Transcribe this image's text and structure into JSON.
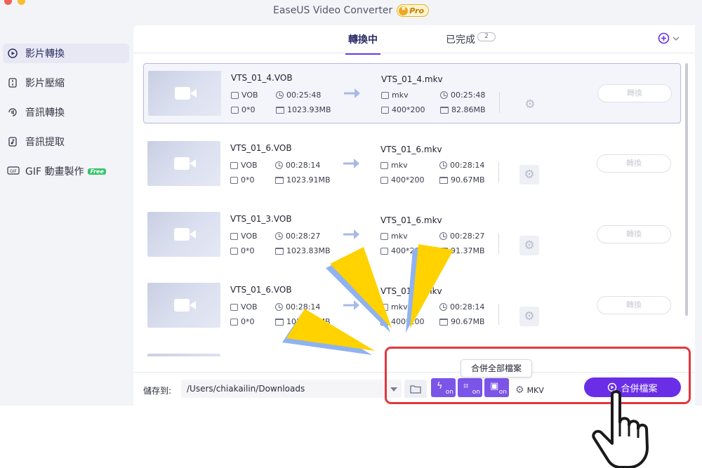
{
  "app": {
    "title": "EaseUS Video Converter",
    "pro_badge": "Pro"
  },
  "colors": {
    "accent": "#6a2ee6",
    "selected_row_border": "#b9b6e9",
    "highlight_box": "#e3373c",
    "burst_yellow": "#ffd200",
    "burst_blue": "#8fb2f0"
  },
  "sidebar": {
    "items": [
      {
        "label": "影片轉換",
        "icon": "video-convert-icon",
        "active": true
      },
      {
        "label": "影片壓縮",
        "icon": "compress-icon",
        "active": false
      },
      {
        "label": "音訊轉換",
        "icon": "audio-convert-icon",
        "active": false
      },
      {
        "label": "音訊提取",
        "icon": "audio-extract-icon",
        "active": false
      },
      {
        "label": "GIF 動畫製作",
        "icon": "gif-icon",
        "active": false,
        "badge": "Free"
      }
    ]
  },
  "tabs": [
    {
      "label": "轉換中",
      "active": true
    },
    {
      "label": "已完成",
      "active": false,
      "count": "2"
    }
  ],
  "files": [
    {
      "src_name": "VTS_01_4.VOB",
      "src_format": "VOB",
      "src_duration": "00:25:48",
      "src_resolution": "0*0",
      "src_size": "1023.93MB",
      "dst_name": "VTS_01_4.mkv",
      "dst_format": "mkv",
      "dst_duration": "00:25:48",
      "dst_resolution": "400*200",
      "dst_size": "82.86MB",
      "convert_label": "轉換",
      "selected": true
    },
    {
      "src_name": "VTS_01_6.VOB",
      "src_format": "VOB",
      "src_duration": "00:28:14",
      "src_resolution": "0*0",
      "src_size": "1023.91MB",
      "dst_name": "VTS_01_6.mkv",
      "dst_format": "mkv",
      "dst_duration": "00:28:14",
      "dst_resolution": "400*200",
      "dst_size": "90.67MB",
      "convert_label": "轉換",
      "selected": false
    },
    {
      "src_name": "VTS_01_3.VOB",
      "src_format": "VOB",
      "src_duration": "00:28:27",
      "src_resolution": "0*0",
      "src_size": "1023.83MB",
      "dst_name": "VTS_01_6.mkv",
      "dst_format": "mkv",
      "dst_duration": "00:28:27",
      "dst_resolution": "400*200",
      "dst_size": "91.37MB",
      "convert_label": "轉換",
      "selected": false
    },
    {
      "src_name": "VTS_01_6.VOB",
      "src_format": "VOB",
      "src_duration": "00:28:14",
      "src_resolution": "0*0",
      "src_size": "1023.91MB",
      "dst_name": "VTS_01_6.mkv",
      "dst_format": "mkv",
      "dst_duration": "00:28:14",
      "dst_resolution": "400*200",
      "dst_size": "90.67MB",
      "convert_label": "轉換",
      "selected": false
    }
  ],
  "footer": {
    "save_label": "儲存到:",
    "save_path": "/Users/chiakailin/Downloads",
    "toggle_on": "on",
    "output_format": "MKV",
    "merge_button": "合併檔案",
    "merge_tooltip": "合併全部檔案"
  }
}
